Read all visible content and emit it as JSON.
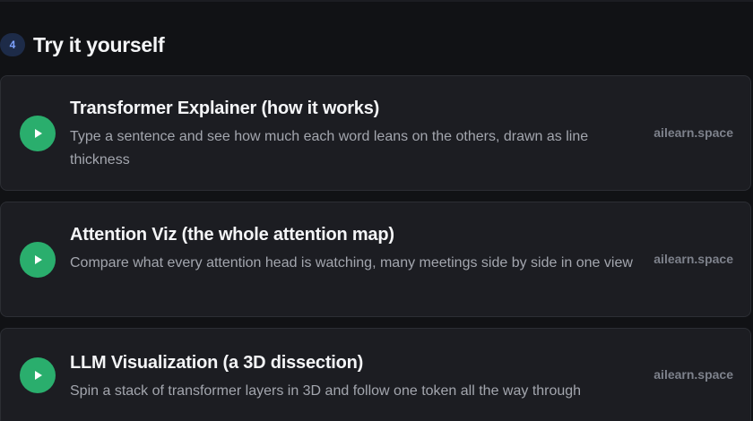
{
  "section": {
    "step_number": "4",
    "title": "Try it yourself"
  },
  "cards": [
    {
      "icon": "play-icon",
      "title": "Transformer Explainer (how it works)",
      "description": "Type a sentence and see how much each word leans on the others, drawn as line thickness",
      "source": "ailearn.space"
    },
    {
      "icon": "play-icon",
      "title": "Attention Viz (the whole attention map)",
      "description": "Compare what every attention head is watching, many meetings side by side in one view",
      "source": "ailearn.space"
    },
    {
      "icon": "play-icon",
      "title": "LLM Visualization (a 3D dissection)",
      "description": "Spin a stack of transformer layers in 3D and follow one token all the way through",
      "source": "ailearn.space"
    }
  ],
  "colors": {
    "background": "#111215",
    "card_background": "#1c1d22",
    "accent_green": "#2aae6d",
    "badge_background": "#1d2b48",
    "badge_text": "#7ea3ff"
  }
}
